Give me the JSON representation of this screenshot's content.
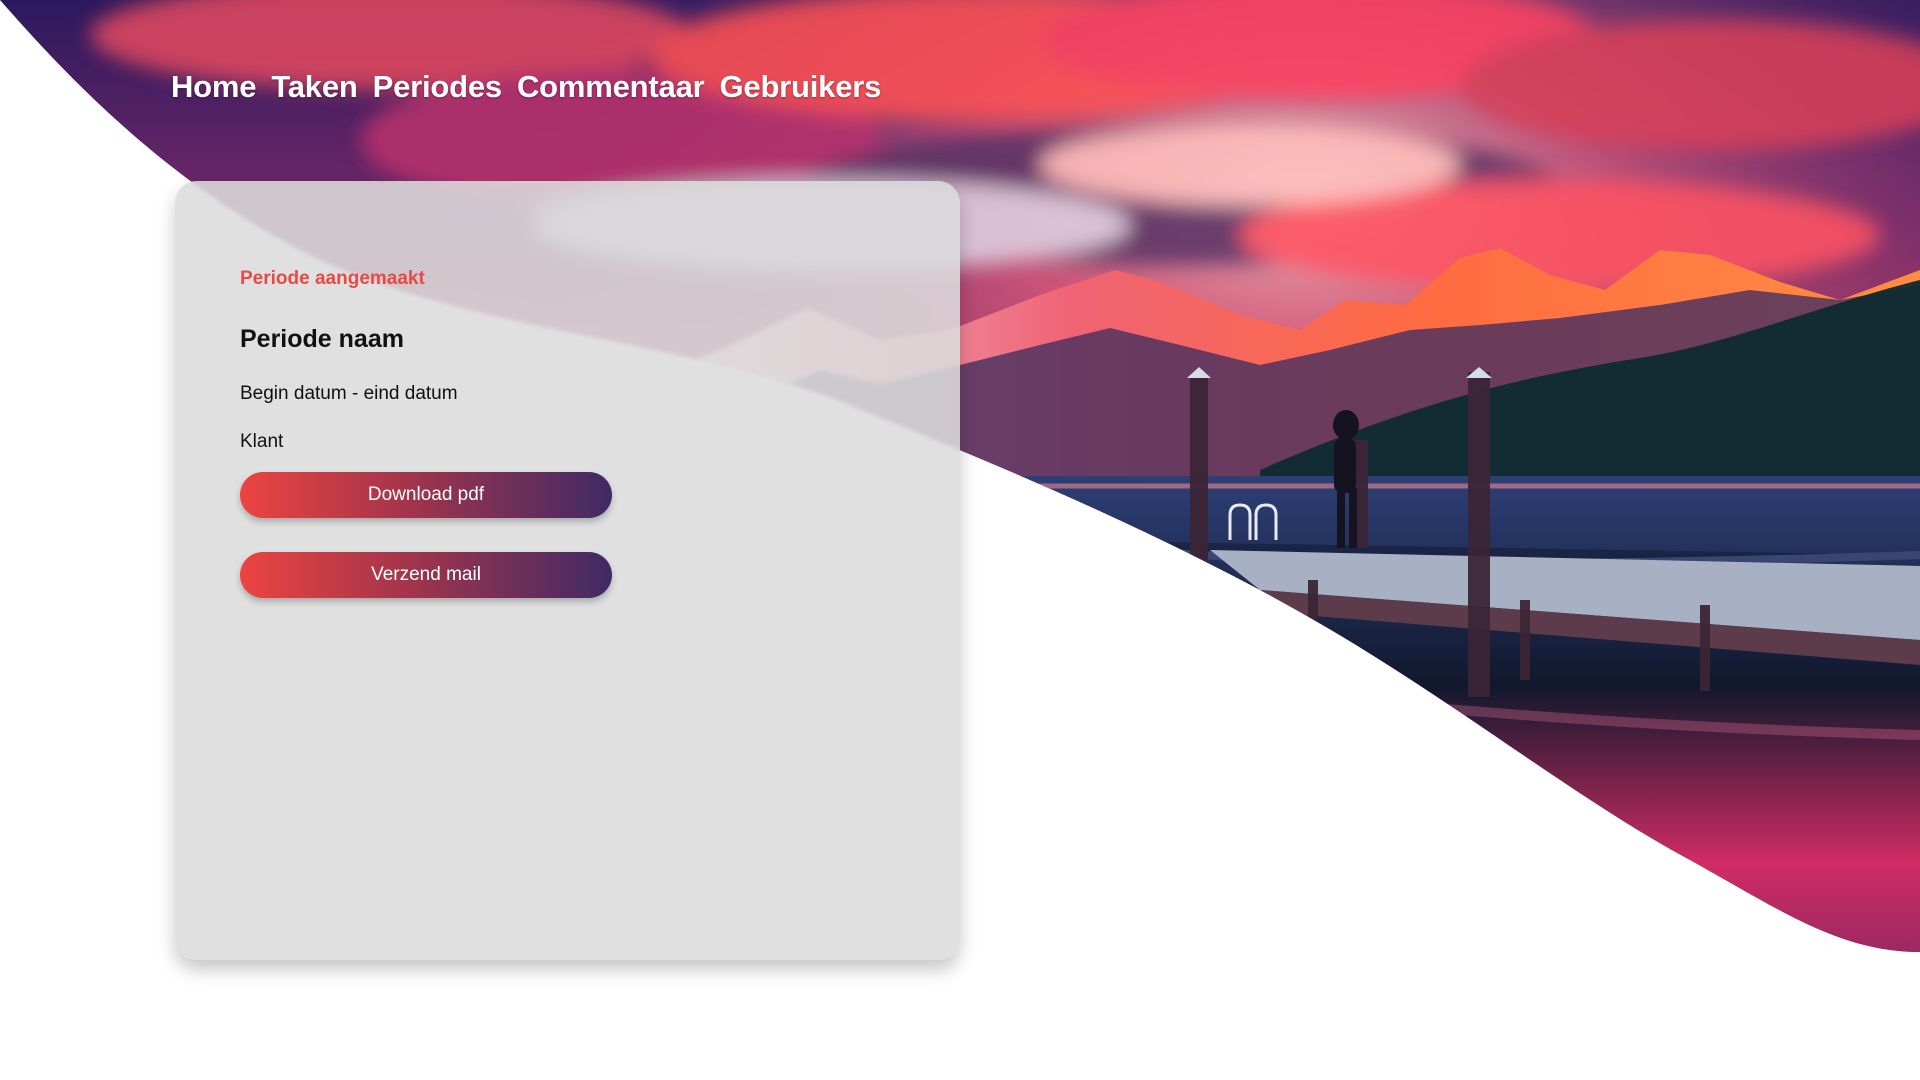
{
  "nav": {
    "items": [
      "Home",
      "Taken",
      "Periodes",
      "Commentaar",
      "Gebruikers"
    ]
  },
  "period_card": {
    "status": "Periode aangemaakt",
    "title": "Periode naam",
    "date_range": "Begin datum - eind datum",
    "client": "Klant",
    "buttons": {
      "download": "Download pdf",
      "mail": "Verzend mail"
    }
  },
  "theme": {
    "accent": "#e94a45",
    "button_gradient_start": "#ec4440",
    "button_gradient_end": "#3f2a65",
    "card_background": "#dedede"
  }
}
